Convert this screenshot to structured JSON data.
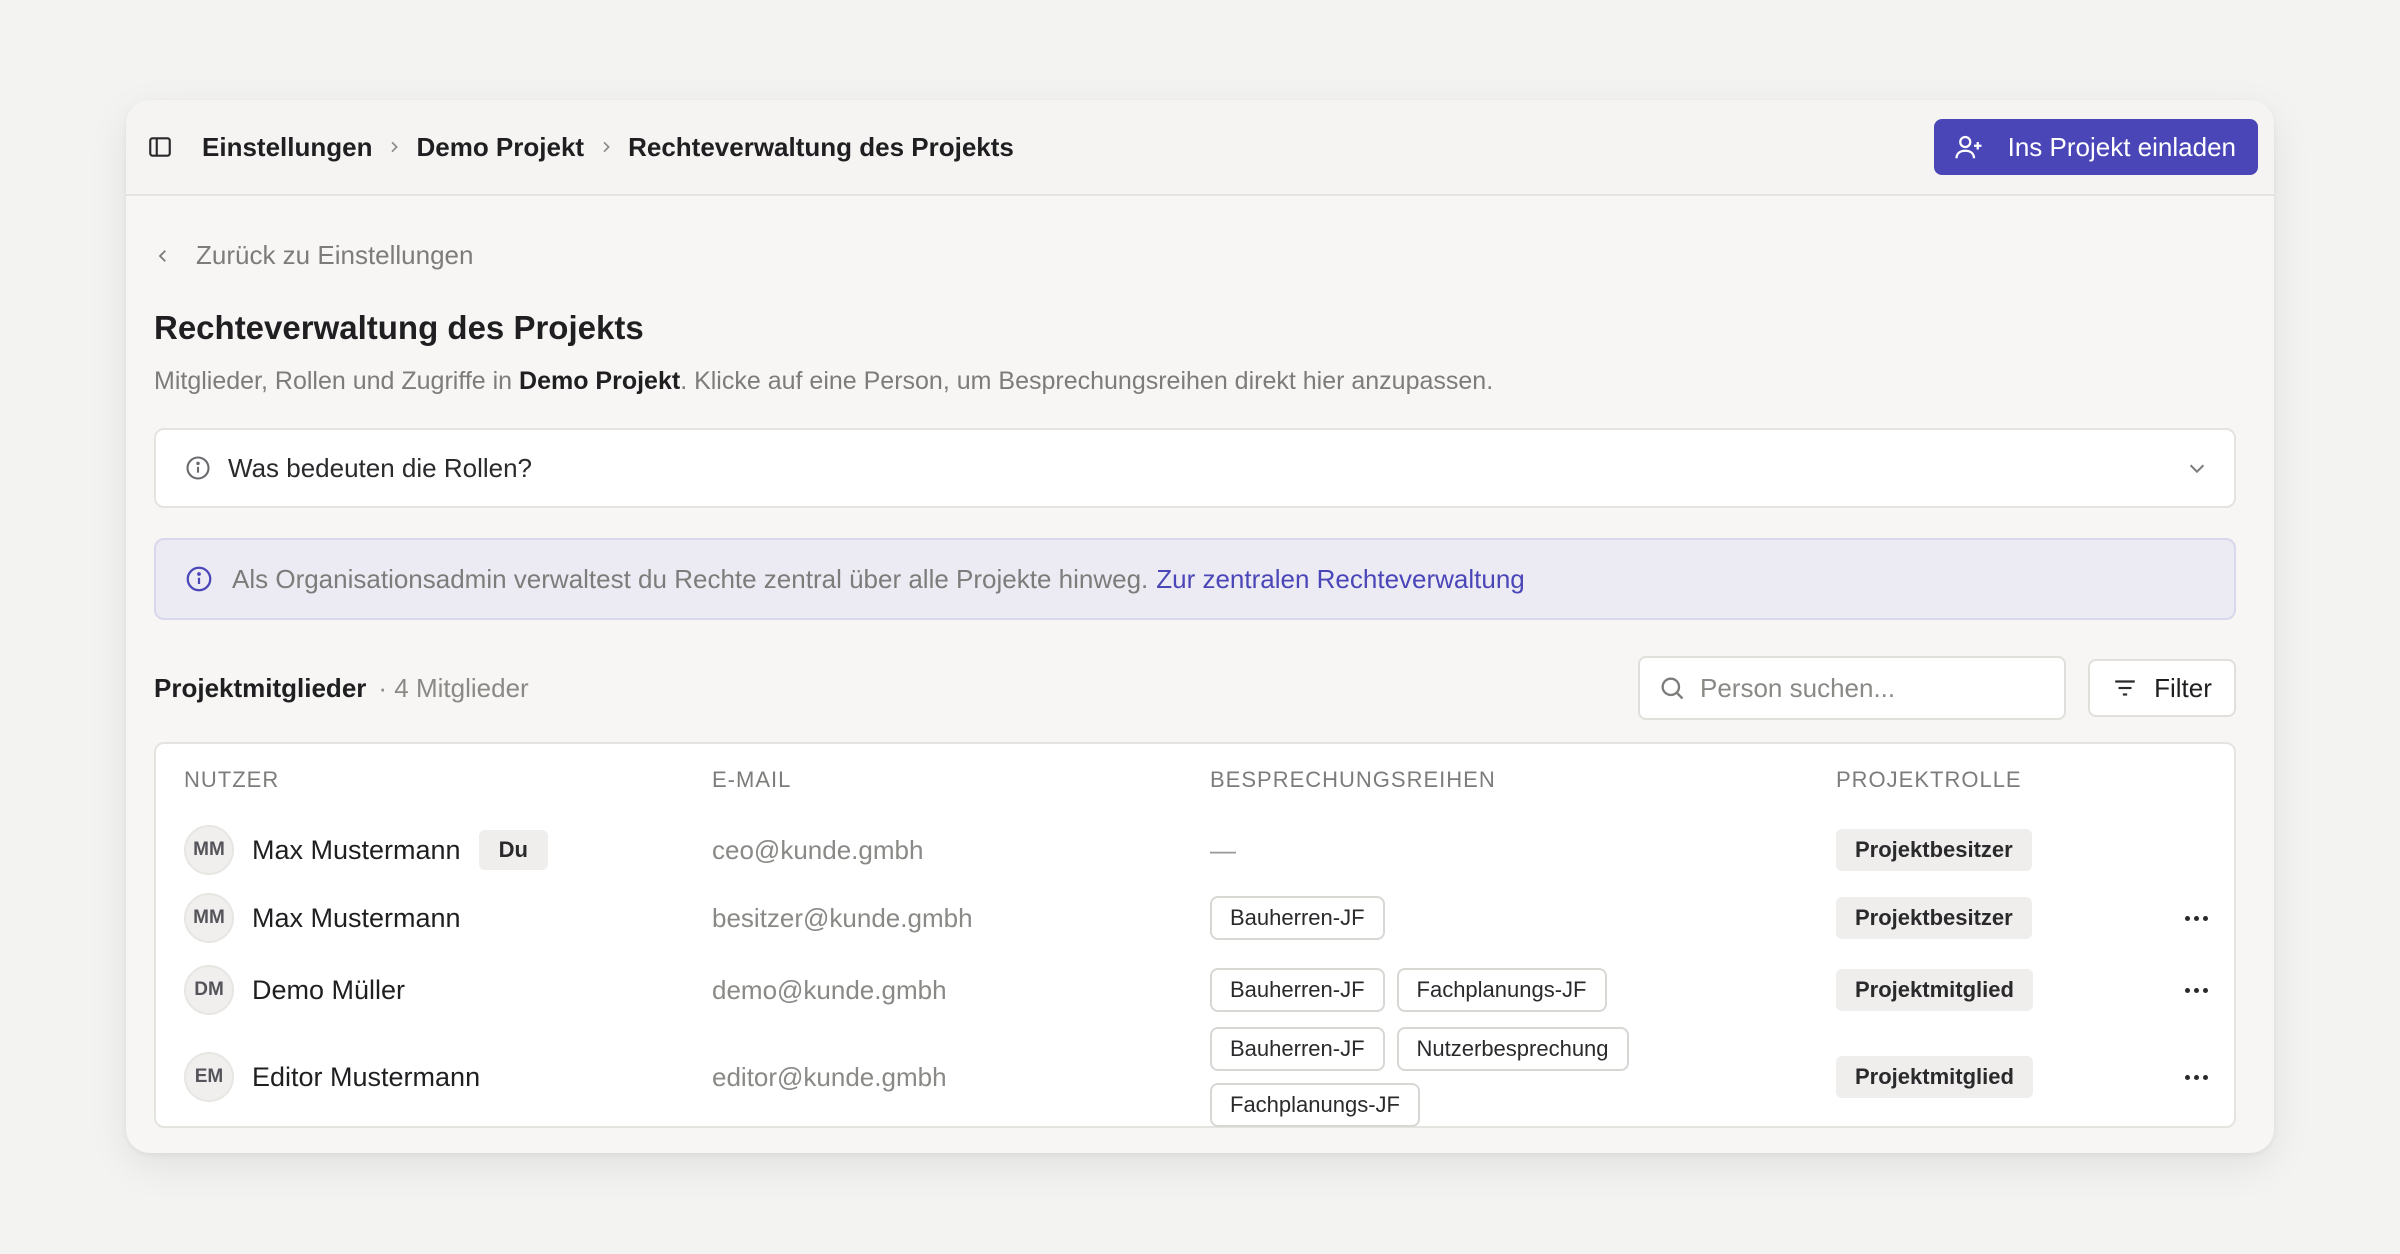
{
  "topbar": {
    "breadcrumbs": [
      "Einstellungen",
      "Demo Projekt",
      "Rechteverwaltung des Projekts"
    ],
    "invite_label": "Ins Projekt einladen"
  },
  "back_label": "Zurück zu Einstellungen",
  "page_title": "Rechteverwaltung des Projekts",
  "subtitle": {
    "prefix": "Mitglieder, Rollen und Zugriffe in ",
    "project": "Demo Projekt",
    "suffix": ". Klicke auf eine Person, um Besprechungsreihen direkt hier anzupassen."
  },
  "roles_box_label": "Was bedeuten die Rollen?",
  "admin_note": {
    "text": "Als Organisationsadmin verwaltest du Rechte zentral über alle Projekte hinweg.",
    "link": "Zur zentralen Rechteverwaltung"
  },
  "members": {
    "title": "Projektmitglieder",
    "count": "· 4 Mitglieder",
    "search_placeholder": "Person suchen...",
    "filter_label": "Filter"
  },
  "table": {
    "headers": [
      "NUTZER",
      "E-MAIL",
      "BESPRECHUNGSREIHEN",
      "PROJEKTROLLE"
    ],
    "rows": [
      {
        "initials": "MM",
        "name": "Max Mustermann",
        "badge": "Du",
        "email": "ceo@kunde.gmbh",
        "series_empty": "—",
        "role": "Projektbesitzer"
      },
      {
        "initials": "MM",
        "name": "Max Mustermann",
        "email": "besitzer@kunde.gmbh",
        "series": [
          "Bauherren-JF"
        ],
        "role": "Projektbesitzer"
      },
      {
        "initials": "DM",
        "name": "Demo Müller",
        "email": "demo@kunde.gmbh",
        "series": [
          "Bauherren-JF",
          "Fachplanungs-JF"
        ],
        "role": "Projektmitglied"
      },
      {
        "initials": "EM",
        "name": "Editor Mustermann",
        "email": "editor@kunde.gmbh",
        "series": [
          "Bauherren-JF",
          "Nutzerbesprechung",
          "Fachplanungs-JF"
        ],
        "role": "Projektmitglied"
      }
    ]
  },
  "colors": {
    "accent": "#4b46b8",
    "background": "#f3f3f2"
  }
}
